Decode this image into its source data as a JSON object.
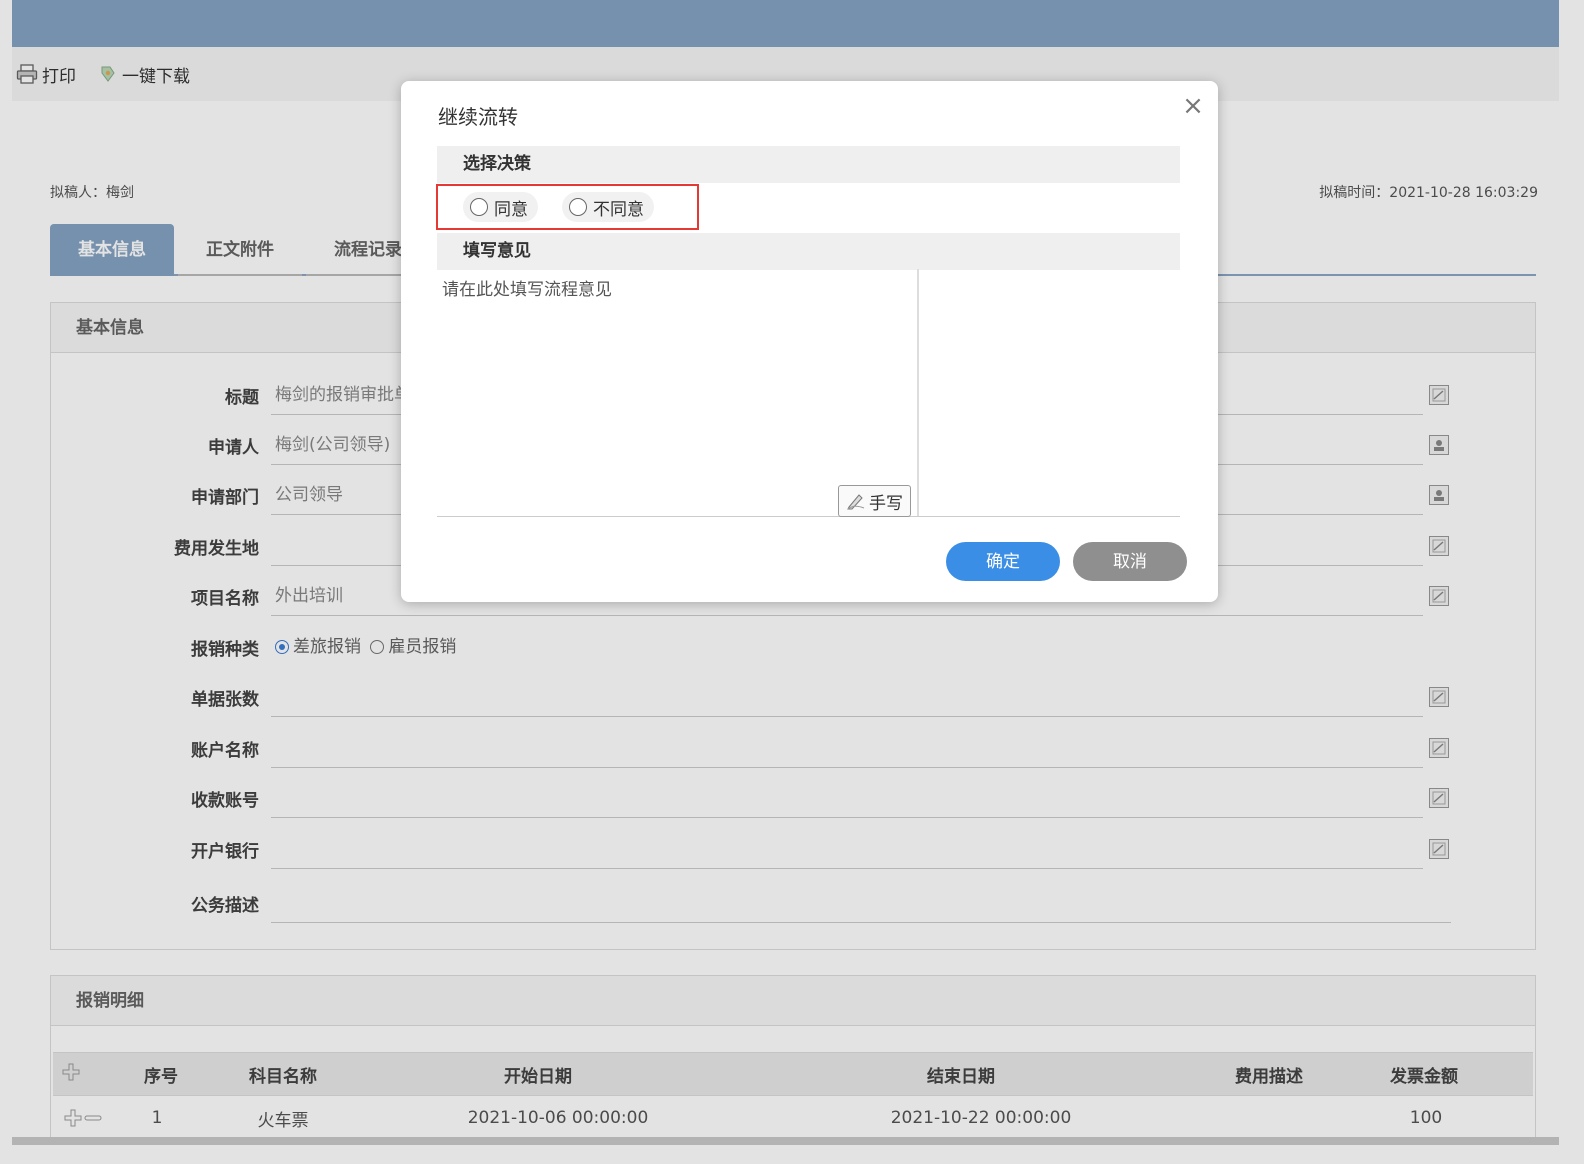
{
  "toolbar": {
    "print_label": "打印",
    "download_label": "一键下载"
  },
  "meta": {
    "drafter": "拟稿人：梅剑",
    "draft_time": "拟稿时间：2021-10-28 16:03:29"
  },
  "tabs": [
    {
      "label": "基本信息"
    },
    {
      "label": "正文附件"
    },
    {
      "label": "流程记录"
    }
  ],
  "basic_panel": {
    "title": "基本信息",
    "fields": [
      {
        "label": "标题",
        "value": "梅剑的报销审批单"
      },
      {
        "label": "申请人",
        "value": "梅剑(公司领导)"
      },
      {
        "label": "申请部门",
        "value": "公司领导"
      },
      {
        "label": "费用发生地",
        "value": ""
      },
      {
        "label": "项目名称",
        "value": "外出培训"
      },
      {
        "label": "报销种类",
        "options": [
          "差旅报销",
          "雇员报销"
        ],
        "selected": "差旅报销"
      },
      {
        "label": "单据张数",
        "value": ""
      },
      {
        "label": "账户名称",
        "value": ""
      },
      {
        "label": "收款账号",
        "value": ""
      },
      {
        "label": "开户银行",
        "value": ""
      },
      {
        "label": "公务描述",
        "value": ""
      }
    ]
  },
  "detail_panel": {
    "title": "报销明细",
    "columns": [
      "序号",
      "科目名称",
      "开始日期",
      "结束日期",
      "费用描述",
      "发票金额"
    ],
    "rows": [
      {
        "no": "1",
        "subject": "火车票",
        "start": "2021-10-06 00:00:00",
        "end": "2021-10-22 00:00:00",
        "desc": "",
        "amount": "100"
      }
    ]
  },
  "modal": {
    "title": "继续流转",
    "close_glyph": "×",
    "decision_heading": "选择决策",
    "decision_options": [
      "同意",
      "不同意"
    ],
    "opinion_heading": "填写意见",
    "opinion_placeholder": "请在此处填写流程意见",
    "handwrite_label": "手写",
    "ok_label": "确定",
    "cancel_label": "取消"
  },
  "icons": {
    "print": "printer-icon",
    "download": "download-icon",
    "edit": "edit-icon",
    "user": "user-icon",
    "handwrite": "pen-icon",
    "add": "plus-icon",
    "remove": "minus-icon"
  }
}
